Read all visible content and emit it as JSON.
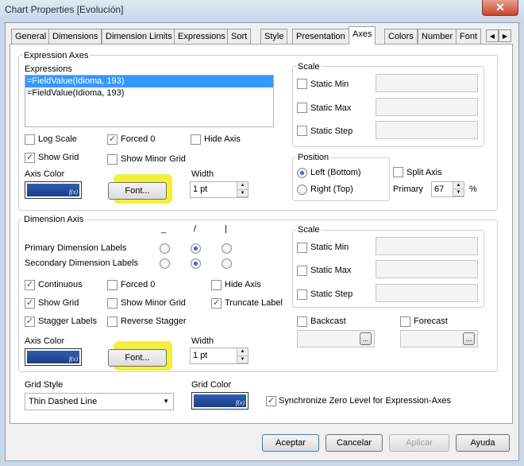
{
  "window": {
    "title": "Chart Properties [Evolución]",
    "close_glyph": "✕"
  },
  "tabs": [
    "General",
    "Dimensions",
    "Dimension Limits",
    "Expressions",
    "Sort",
    "Style",
    "Presentation",
    "Axes",
    "Colors",
    "Number",
    "Font"
  ],
  "active_tab": "Axes",
  "expression_axes": {
    "legend": "Expression Axes",
    "expressions_label": "Expressions",
    "expressions": [
      "=FieldValue(Idioma, 193)",
      "=FieldValue(Idioma, 193)"
    ],
    "selected_index": 0,
    "log_scale": {
      "label": "Log Scale",
      "checked": false
    },
    "forced_0": {
      "label": "Forced 0",
      "checked": true
    },
    "hide_axis": {
      "label": "Hide Axis",
      "checked": false
    },
    "show_grid": {
      "label": "Show Grid",
      "checked": true
    },
    "show_minor_grid": {
      "label": "Show Minor Grid",
      "checked": false
    },
    "axis_color_label": "Axis Color",
    "font_button": "Font...",
    "width_label": "Width",
    "width_value": "1 pt",
    "scale": {
      "legend": "Scale",
      "static_min": "Static Min",
      "static_max": "Static Max",
      "static_step": "Static Step"
    },
    "position": {
      "legend": "Position",
      "left_bottom": "Left (Bottom)",
      "right_top": "Right (Top)",
      "selected": "left_bottom"
    },
    "split_axis": {
      "label": "Split Axis",
      "checked": false
    },
    "primary_label": "Primary",
    "primary_value": "67",
    "primary_unit": "%"
  },
  "dimension_axis": {
    "legend": "Dimension Axis",
    "orientation_headers": [
      "_",
      "/",
      "|"
    ],
    "primary_labels": "Primary Dimension Labels",
    "secondary_labels": "Secondary Dimension Labels",
    "primary_selected": 1,
    "secondary_selected": 1,
    "continuous": {
      "label": "Continuous",
      "checked": true
    },
    "forced_0": {
      "label": "Forced 0",
      "checked": false
    },
    "hide_axis": {
      "label": "Hide Axis",
      "checked": false
    },
    "show_grid": {
      "label": "Show Grid",
      "checked": true
    },
    "show_minor_grid": {
      "label": "Show Minor Grid",
      "checked": false
    },
    "truncate_label": {
      "label": "Truncate Label",
      "checked": true
    },
    "stagger_labels": {
      "label": "Stagger Labels",
      "checked": true
    },
    "reverse_stagger": {
      "label": "Reverse Stagger",
      "checked": false
    },
    "axis_color_label": "Axis Color",
    "font_button": "Font...",
    "width_label": "Width",
    "width_value": "1 pt",
    "scale": {
      "legend": "Scale",
      "static_min": "Static Min",
      "static_max": "Static Max",
      "static_step": "Static Step"
    },
    "backcast": {
      "label": "Backcast",
      "checked": false
    },
    "forecast": {
      "label": "Forecast",
      "checked": false
    },
    "ellipsis": "..."
  },
  "grid_style": {
    "label": "Grid Style",
    "value": "Thin Dashed Line"
  },
  "grid_color_label": "Grid Color",
  "sync_zero": {
    "label": "Synchronize Zero Level for Expression-Axes",
    "checked": true
  },
  "buttons": {
    "accept": "Aceptar",
    "cancel": "Cancelar",
    "apply": "Aplicar",
    "help": "Ayuda"
  },
  "colors": {
    "axis_color": "#2a56a6",
    "highlight": "#f3ef3d"
  },
  "icons": {
    "color_function": "f(x)",
    "check": "✓",
    "spin_up": "▲",
    "spin_down": "▼",
    "dropdown": "▼",
    "scroll_left": "◀",
    "scroll_right": "▶"
  }
}
